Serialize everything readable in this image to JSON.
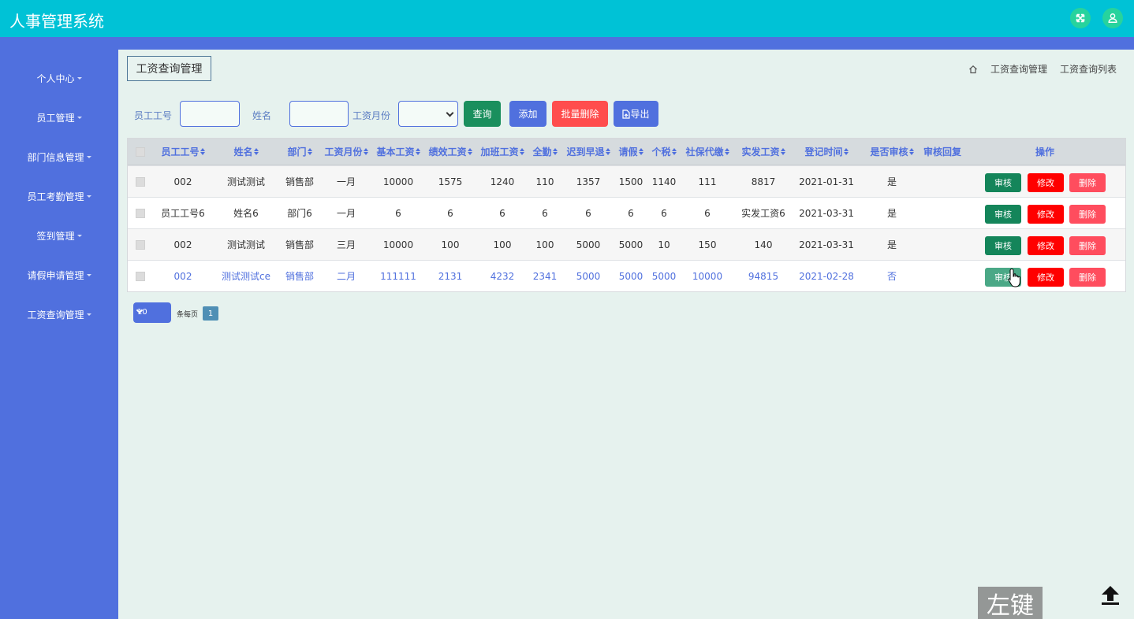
{
  "app": {
    "title": "人事管理系统"
  },
  "sidebar": {
    "items": [
      {
        "label": "个人中心"
      },
      {
        "label": "员工管理"
      },
      {
        "label": "部门信息管理"
      },
      {
        "label": "员工考勤管理"
      },
      {
        "label": "签到管理"
      },
      {
        "label": "请假申请管理"
      },
      {
        "label": "工资查询管理"
      }
    ]
  },
  "page": {
    "title": "工资查询管理"
  },
  "breadcrumb": {
    "items": [
      "工资查询管理",
      "工资查询列表"
    ]
  },
  "search": {
    "employee_id_label": "员工工号",
    "employee_id_value": "",
    "name_label": "姓名",
    "name_value": "",
    "month_label": "工资月份",
    "month_value": ""
  },
  "toolbar": {
    "query_label": "查询",
    "add_label": "添加",
    "batch_delete_label": "批量删除",
    "export_label": "导出"
  },
  "table": {
    "headers": [
      "员工工号",
      "姓名",
      "部门",
      "工资月份",
      "基本工资",
      "绩效工资",
      "加班工资",
      "全勤",
      "迟到早退",
      "请假",
      "个税",
      "社保代缴",
      "实发工资",
      "登记时间",
      "是否审核",
      "审核回复",
      "操作"
    ],
    "rows": [
      [
        "002",
        "测试测试",
        "销售部",
        "一月",
        "10000",
        "1575",
        "1240",
        "110",
        "1357",
        "1500",
        "1140",
        "111",
        "8817",
        "2021-01-31",
        "是",
        ""
      ],
      [
        "员工工号6",
        "姓名6",
        "部门6",
        "一月",
        "6",
        "6",
        "6",
        "6",
        "6",
        "6",
        "6",
        "6",
        "实发工资6",
        "2021-03-31",
        "是",
        ""
      ],
      [
        "002",
        "测试测试",
        "销售部",
        "三月",
        "10000",
        "100",
        "100",
        "100",
        "5000",
        "5000",
        "10",
        "150",
        "140",
        "2021-03-31",
        "是",
        ""
      ],
      [
        "002",
        "测试测试ce",
        "销售部",
        "二月",
        "111111",
        "2131",
        "4232",
        "2341",
        "5000",
        "5000",
        "5000",
        "10000",
        "94815",
        "2021-02-28",
        "否",
        ""
      ]
    ],
    "actions": {
      "review": "审核",
      "edit": "修改",
      "delete": "删除"
    }
  },
  "pagination": {
    "page_size": "10",
    "per_page_label": "条每页",
    "current_page": "1"
  },
  "overlay": {
    "key_hint": "左键"
  },
  "colors": {
    "topbar": "#00c2d6",
    "sidebar": "#5070de",
    "page_bg": "#e6f2ee",
    "query": "#1a8f5d",
    "add": "#5070de",
    "batch_delete": "#ff4d4d",
    "review": "#14855a",
    "edit": "#ff0000",
    "delete": "#ff4d5e"
  },
  "icons": [
    "fullscreen-icon",
    "user-icon",
    "home-icon",
    "export-file-icon",
    "back-to-top-icon",
    "hand-cursor-icon"
  ]
}
